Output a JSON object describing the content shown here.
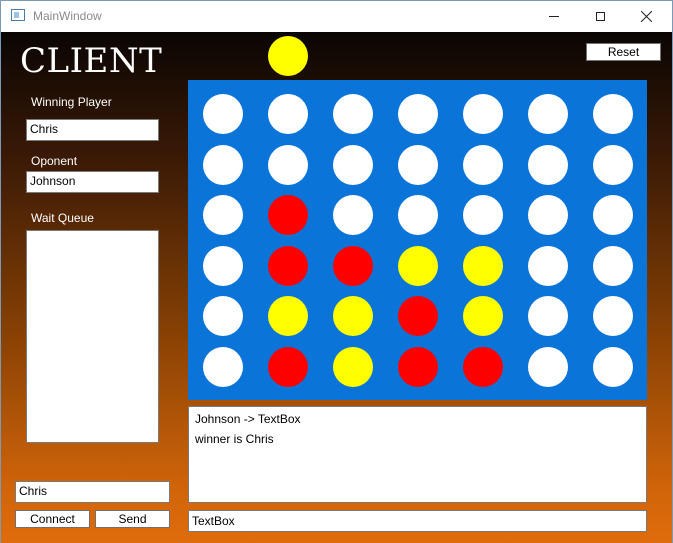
{
  "window": {
    "title": "MainWindow"
  },
  "header": {
    "title": "CLIENT",
    "reset_label": "Reset"
  },
  "sidebar": {
    "winning_label": "Winning Player",
    "winning_value": "Chris",
    "opponent_label": "Oponent",
    "opponent_value": "Johnson",
    "queue_label": "Wait Queue",
    "name_value": "Chris",
    "connect_label": "Connect",
    "send_label": "Send"
  },
  "colors": {
    "red": "#ff0000",
    "yellow": "#ffff00",
    "empty": "#ffffff",
    "board": "#0a74d8"
  },
  "turn_color": "yellow",
  "board": [
    [
      "empty",
      "empty",
      "empty",
      "empty",
      "empty",
      "empty",
      "empty"
    ],
    [
      "empty",
      "empty",
      "empty",
      "empty",
      "empty",
      "empty",
      "empty"
    ],
    [
      "empty",
      "red",
      "empty",
      "empty",
      "empty",
      "empty",
      "empty"
    ],
    [
      "empty",
      "red",
      "red",
      "yellow",
      "yellow",
      "empty",
      "empty"
    ],
    [
      "empty",
      "yellow",
      "yellow",
      "red",
      "yellow",
      "empty",
      "empty"
    ],
    [
      "empty",
      "red",
      "yellow",
      "red",
      "red",
      "empty",
      "empty"
    ]
  ],
  "log": {
    "lines": [
      " Johnson -> TextBox",
      "winner is Chris"
    ]
  },
  "message_input": {
    "value": "TextBox"
  }
}
